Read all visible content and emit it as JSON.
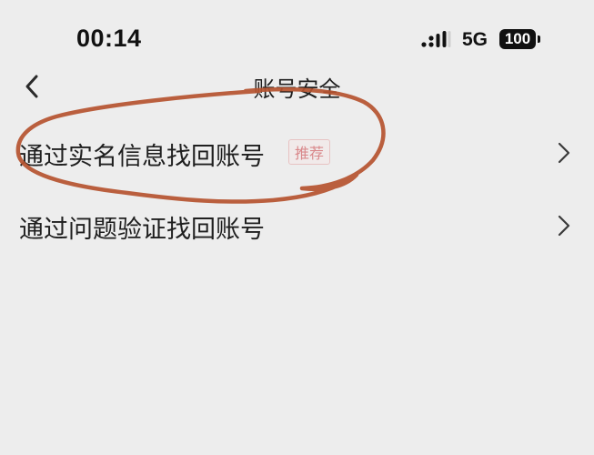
{
  "status_bar": {
    "time": "00:14",
    "network": "5G",
    "battery": "100",
    "icons": [
      "signal-icon",
      "battery-icon"
    ]
  },
  "nav": {
    "title": "账号安全",
    "back_icon": "chevron-left-icon"
  },
  "options": [
    {
      "label": "通过实名信息找回账号",
      "badge": "推荐",
      "icon": "chevron-right-icon"
    },
    {
      "label": "通过问题验证找回账号",
      "icon": "chevron-right-icon"
    }
  ],
  "colors": {
    "background": "#ededed",
    "text": "#1f1f1f",
    "badge_text": "#d9888b",
    "badge_border": "#e7c3c3",
    "annotation_stroke": "#b5532f"
  }
}
